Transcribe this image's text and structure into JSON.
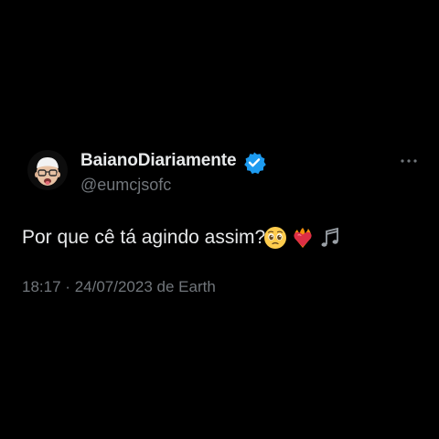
{
  "tweet": {
    "author": {
      "display_name": "BaianoDiariamente",
      "handle": "@eumcjsofc",
      "verified": true,
      "avatar_icon": "memoji-avatar-icon"
    },
    "text": "Por que cê tá agindo assim?",
    "emojis": [
      "pleading-face-emoji",
      "heart-on-fire-emoji",
      "musical-notes-emoji"
    ],
    "meta": {
      "time": "18:17",
      "separator": "·",
      "date": "24/07/2023",
      "source": "de Earth",
      "full": "18:17 · 24/07/2023 de Earth"
    }
  },
  "colors": {
    "background": "#000000",
    "primary_text": "#e7e9ea",
    "secondary_text": "#71767b",
    "verified_blue": "#1d9bf0"
  }
}
